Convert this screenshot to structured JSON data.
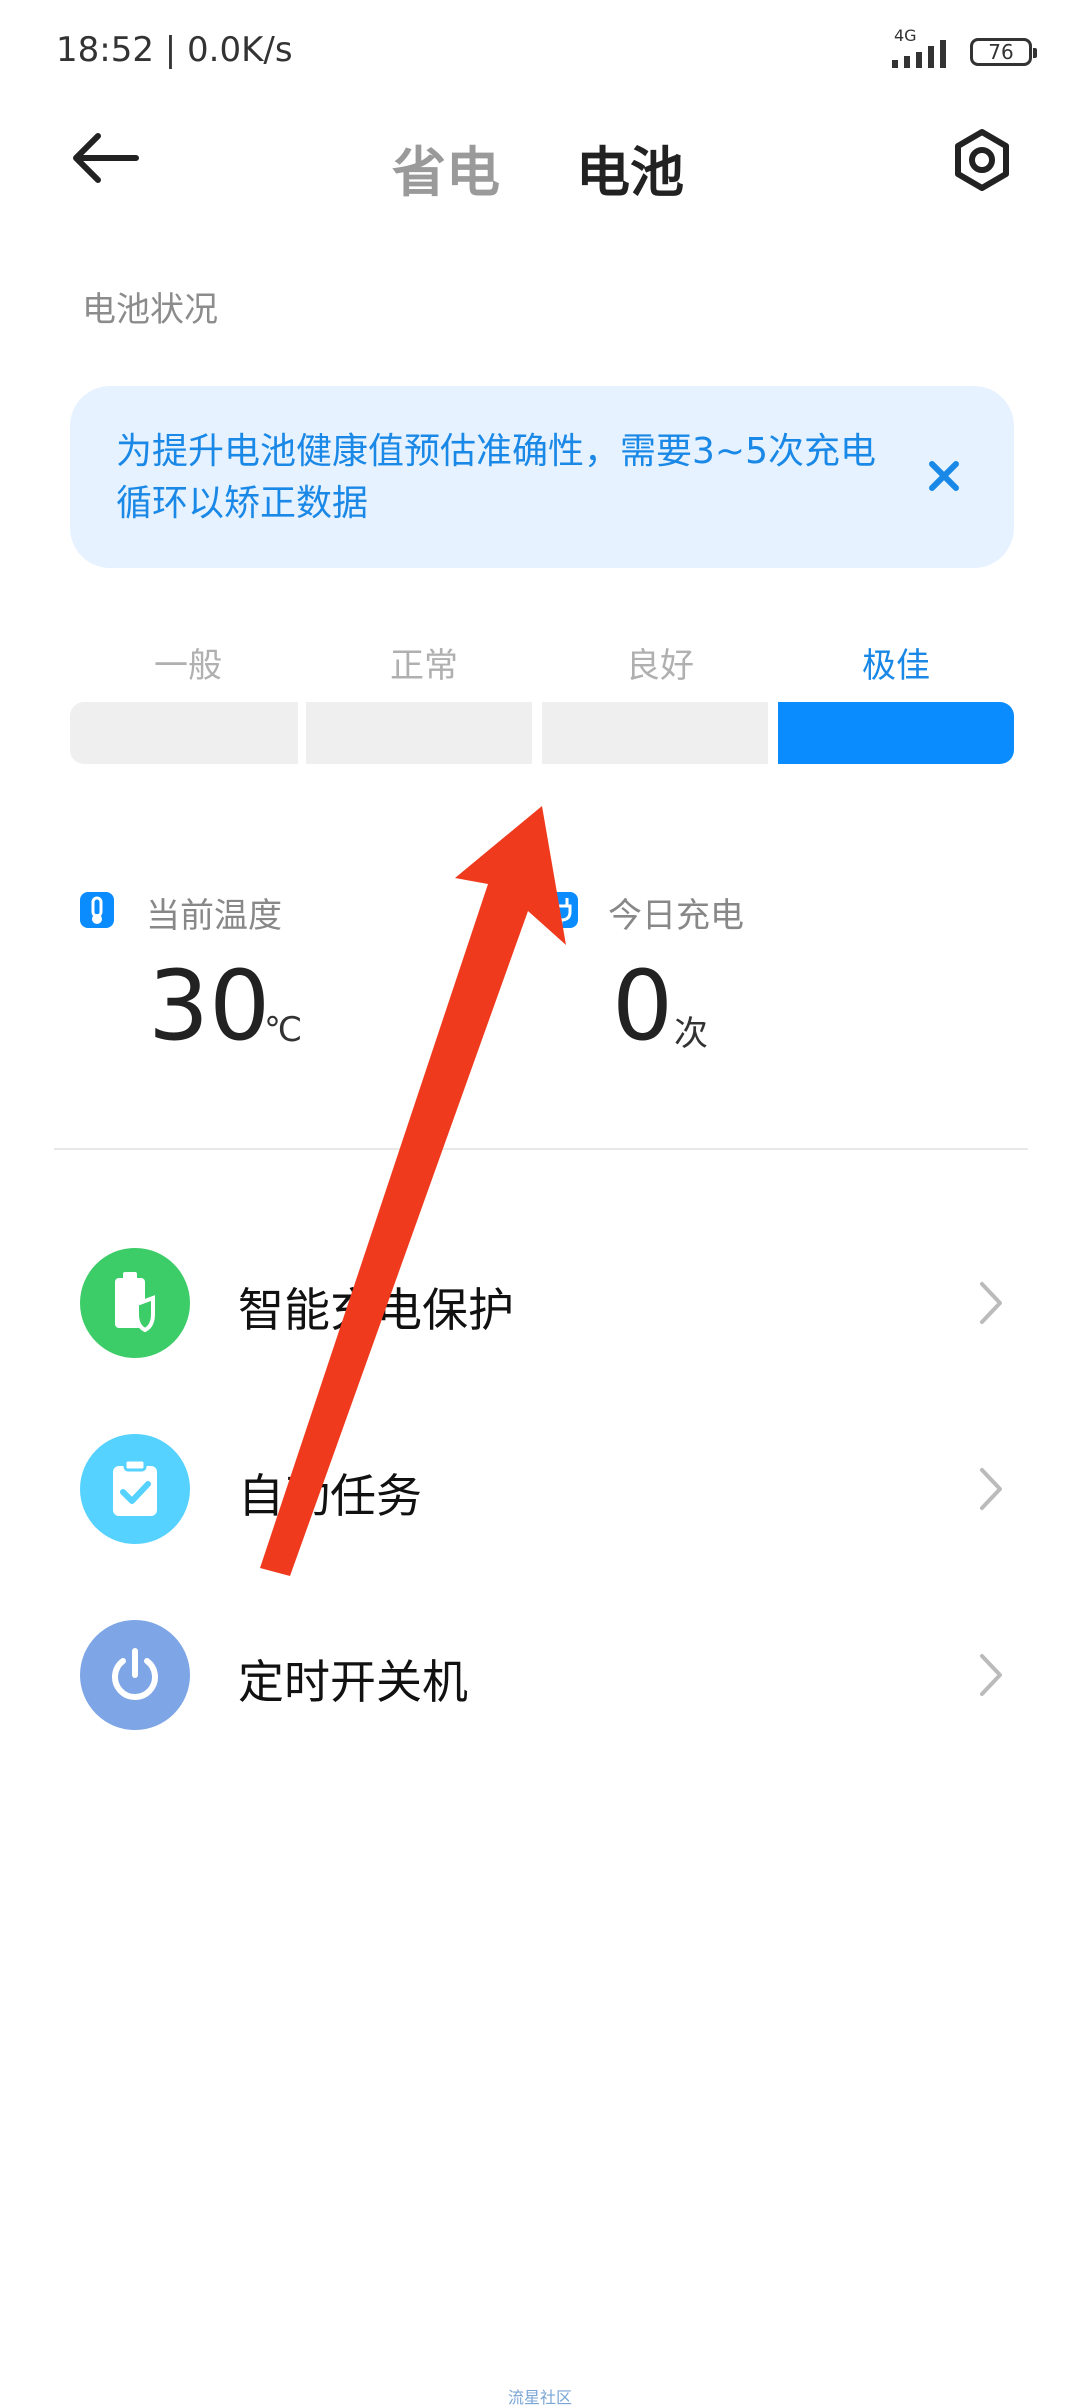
{
  "status_bar": {
    "time": "18:52 | 0.0K/s",
    "network": "4G",
    "battery": "76"
  },
  "header": {
    "tabs": [
      {
        "label": "省电",
        "active": false
      },
      {
        "label": "电池",
        "active": true
      }
    ],
    "back_icon": "arrow-left-icon",
    "settings_icon": "settings-gear-icon"
  },
  "battery_status": {
    "title": "电池状况",
    "banner": {
      "text": "为提升电池健康值预估准确性，需要3~5次充电循环以矫正数据",
      "close_icon": "close-icon"
    },
    "levels": [
      "一般",
      "正常",
      "良好",
      "极佳"
    ],
    "active_level_index": 3
  },
  "stats": {
    "temperature": {
      "label": "当前温度",
      "value": "30",
      "unit": "℃"
    },
    "charge_today": {
      "label": "今日充电",
      "value": "0",
      "unit": "次"
    }
  },
  "menu": [
    {
      "label": "智能充电保护",
      "icon": "battery-shield-icon",
      "color": "#3ccd68"
    },
    {
      "label": "自动任务",
      "icon": "clipboard-check-icon",
      "color": "#55d2ff"
    },
    {
      "label": "定时开关机",
      "icon": "power-icon",
      "color": "#7ea6e6"
    }
  ],
  "footer": {
    "text": "流星社区"
  },
  "colors": {
    "accent": "#0a8cff",
    "banner_bg": "#e6f2ff",
    "annotation_arrow": "#f03a1e"
  }
}
